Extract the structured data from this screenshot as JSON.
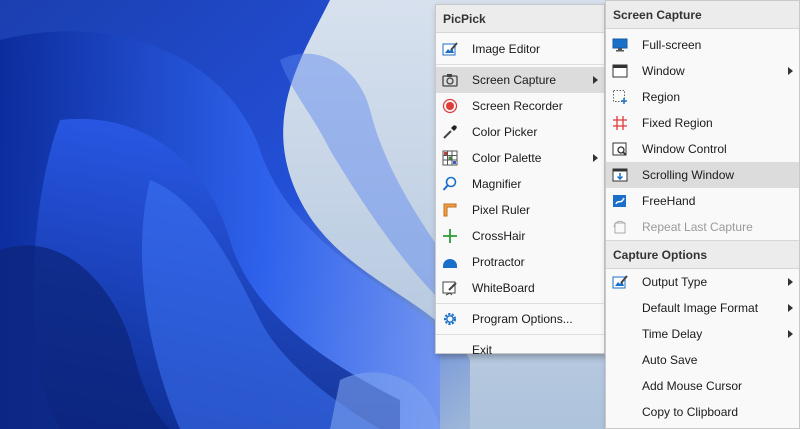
{
  "main_menu": {
    "title": "PicPick",
    "items": [
      {
        "label": "Image Editor",
        "icon": "image-editor-icon"
      },
      {
        "label": "Screen Capture",
        "icon": "camera-icon",
        "submenu": true,
        "highlight": true
      },
      {
        "label": "Screen Recorder",
        "icon": "record-icon"
      },
      {
        "label": "Color Picker",
        "icon": "eyedropper-icon"
      },
      {
        "label": "Color Palette",
        "icon": "palette-grid-icon",
        "submenu": true
      },
      {
        "label": "Magnifier",
        "icon": "magnifier-icon"
      },
      {
        "label": "Pixel Ruler",
        "icon": "ruler-icon"
      },
      {
        "label": "CrossHair",
        "icon": "crosshair-icon"
      },
      {
        "label": "Protractor",
        "icon": "protractor-icon"
      },
      {
        "label": "WhiteBoard",
        "icon": "whiteboard-icon"
      },
      {
        "label": "Program Options...",
        "icon": "gear-icon"
      },
      {
        "label": "Exit"
      }
    ]
  },
  "submenu": {
    "title": "Screen Capture",
    "items": [
      {
        "label": "Full-screen",
        "icon": "monitor-icon"
      },
      {
        "label": "Window",
        "icon": "window-icon",
        "submenu": true
      },
      {
        "label": "Region",
        "icon": "region-icon"
      },
      {
        "label": "Fixed Region",
        "icon": "fixed-region-icon"
      },
      {
        "label": "Window Control",
        "icon": "window-control-icon"
      },
      {
        "label": "Scrolling Window",
        "icon": "scrolling-window-icon",
        "highlight": true
      },
      {
        "label": "FreeHand",
        "icon": "freehand-icon"
      },
      {
        "label": "Repeat Last Capture",
        "icon": "repeat-capture-icon",
        "disabled": true
      }
    ],
    "options_title": "Capture Options",
    "options": [
      {
        "label": "Output Type",
        "icon": "output-type-icon",
        "submenu": true
      },
      {
        "label": "Default Image Format",
        "submenu": true
      },
      {
        "label": "Time Delay",
        "submenu": true
      },
      {
        "label": "Auto Save"
      },
      {
        "label": "Add Mouse Cursor"
      },
      {
        "label": "Copy to Clipboard"
      }
    ]
  },
  "colors": {
    "menu_bg": "#f9f9f9",
    "header_bg": "#ececec",
    "highlight": "#dcdcdc",
    "accent_blue": "#1a6fc9",
    "record_red": "#e03a3a"
  }
}
